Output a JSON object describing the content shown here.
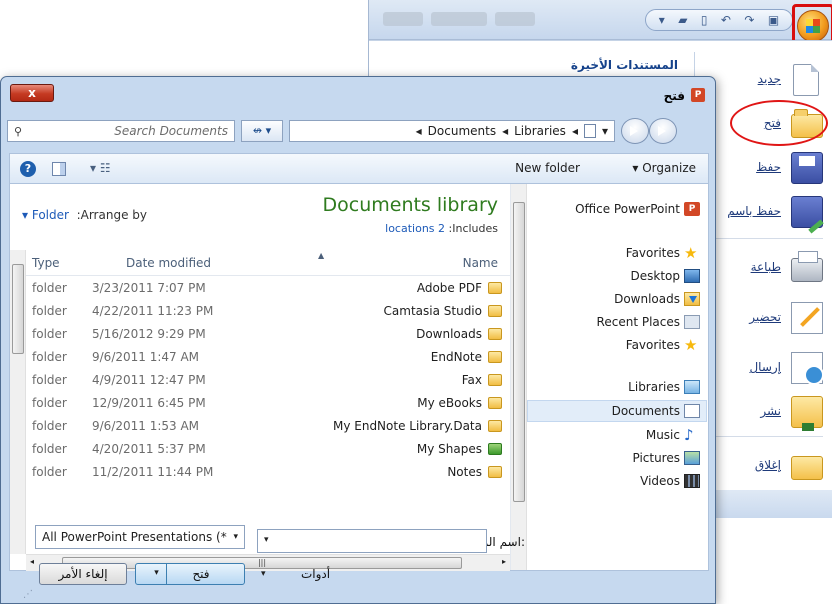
{
  "office": {
    "recent_title": "المستندات الأخيرة",
    "qat_icons": [
      "folder-open-icon",
      "new-document-icon",
      "undo-icon",
      "redo-icon",
      "save-icon"
    ],
    "commands": [
      {
        "label": "جديد",
        "icon": "new-document-icon"
      },
      {
        "label": "فتح",
        "icon": "open-folder-icon"
      },
      {
        "label": "حفظ",
        "icon": "save-icon"
      },
      {
        "label": "حفظ باسم",
        "icon": "save-as-icon"
      },
      {
        "label": "طباعة",
        "icon": "printer-icon"
      },
      {
        "label": "تحضير",
        "icon": "prepare-icon"
      },
      {
        "label": "إرسال",
        "icon": "send-icon"
      },
      {
        "label": "نشر",
        "icon": "publish-icon"
      },
      {
        "label": "إغلاق",
        "icon": "close-folder-icon"
      }
    ]
  },
  "dialog": {
    "title": "فتح",
    "close_label": "x",
    "search_placeholder": "Search Documents",
    "address": [
      "Documents",
      "Libraries"
    ],
    "toolbar": {
      "new_folder": "New folder",
      "organize": "Organize"
    },
    "library": {
      "title": "Documents library",
      "includes_label": ":Includes",
      "includes_link": "locations 2",
      "arrange_label": ":Arrange by",
      "arrange_value": "Folder"
    },
    "columns": {
      "type": "Type",
      "date": "Date modified",
      "name": "Name"
    },
    "files": [
      {
        "type": "folder",
        "date": "3/23/2011 7:07 PM",
        "name": "Adobe PDF"
      },
      {
        "type": "folder",
        "date": "4/22/2011 11:23 PM",
        "name": "Camtasia Studio"
      },
      {
        "type": "folder",
        "date": "5/16/2012 9:29 PM",
        "name": "Downloads"
      },
      {
        "type": "folder",
        "date": "9/6/2011 1:47 AM",
        "name": "EndNote"
      },
      {
        "type": "folder",
        "date": "4/9/2011 12:47 PM",
        "name": "Fax"
      },
      {
        "type": "folder",
        "date": "12/9/2011 6:45 PM",
        "name": "My eBooks"
      },
      {
        "type": "folder",
        "date": "9/6/2011 1:53 AM",
        "name": "My EndNote Library.Data"
      },
      {
        "type": "folder",
        "date": "4/20/2011 5:37 PM",
        "name": "My Shapes"
      },
      {
        "type": "folder",
        "date": "11/2/2011 11:44 PM",
        "name": "Notes"
      }
    ],
    "nav": {
      "app": "Office PowerPoint",
      "favorites_header": "Favorites",
      "favorites": [
        "Desktop",
        "Downloads",
        "Recent Places",
        "Favorites"
      ],
      "libraries_header": "Libraries",
      "libraries": [
        "Documents",
        "Music",
        "Pictures",
        "Videos"
      ],
      "selected": "Documents"
    },
    "footer": {
      "filename_label": "اسم الملف:",
      "filename_value": "",
      "filetype": "All PowerPoint Presentations (*",
      "tools_label": "أدوات",
      "open_label": "فتح",
      "cancel_label": "إلغاء الأمر"
    }
  }
}
